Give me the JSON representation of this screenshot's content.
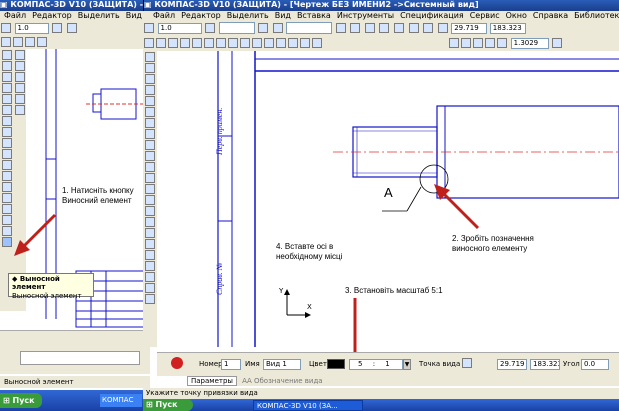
{
  "back_window": {
    "title": "КОМПАС-3D V10 (ЗАЩИТА) - [Чертеж",
    "menu": [
      "Файл",
      "Редактор",
      "Выделить",
      "Вид"
    ],
    "line_width": "1.0",
    "popup": {
      "title": "Выносной элемент",
      "subtitle": "Выносной элемент"
    },
    "status_text": "Выносной элемент"
  },
  "front_window": {
    "title": "КОМПАС-3D V10 (ЗАЩИТА) - [Чертеж БЕЗ ИМЕНИ2 ->Системный вид]",
    "menu": [
      "Файл",
      "Редактор",
      "Выделить",
      "Вид",
      "Вставка",
      "Инструменты",
      "Спецификация",
      "Сервис",
      "Окно",
      "Справка",
      "Библиотеки"
    ],
    "line_width": "1.0",
    "coord_x": "29.719",
    "coord_y": "183.323",
    "zoom": "1.3029",
    "stamp_labels": [
      "Перв. примен.",
      "Справ. №"
    ],
    "detail_letter": "А"
  },
  "annotations": {
    "step1": "1. Натисніть кнопку Виносний елемент",
    "step2": "2. Зробіть позначення виносного елементу",
    "step3": "3. Встановіть масштаб 5:1",
    "step4": "4. Вставте осі в необхідному місці"
  },
  "props_panel": {
    "number_label": "Номер",
    "number_value": "1",
    "name_label": "Имя",
    "name_value": "Вид 1",
    "color_label": "Цвет",
    "scale_left": "5",
    "scale_sep": ":",
    "scale_right": "1",
    "point_label": "Точка вида",
    "point_x": "29.719",
    "point_y": "183.323",
    "angle_label": "Угол",
    "angle_value": "0.0",
    "tab_params": "Параметры",
    "tab_label": "Обозначение вида"
  },
  "statusbar": {
    "prompt": "Укажите точку привязки вида"
  },
  "taskbar": {
    "start_left": "Пуск",
    "start_right": "Пуск",
    "task_left": "КОМПАС",
    "task_right": "КОМПАС-3D V10 (ЗА..."
  },
  "colors": {
    "title_blue": "#1f4ea3",
    "drawing_blue": "#1414c8",
    "axis_red": "#e03030",
    "arrow_red": "#c0201c"
  }
}
